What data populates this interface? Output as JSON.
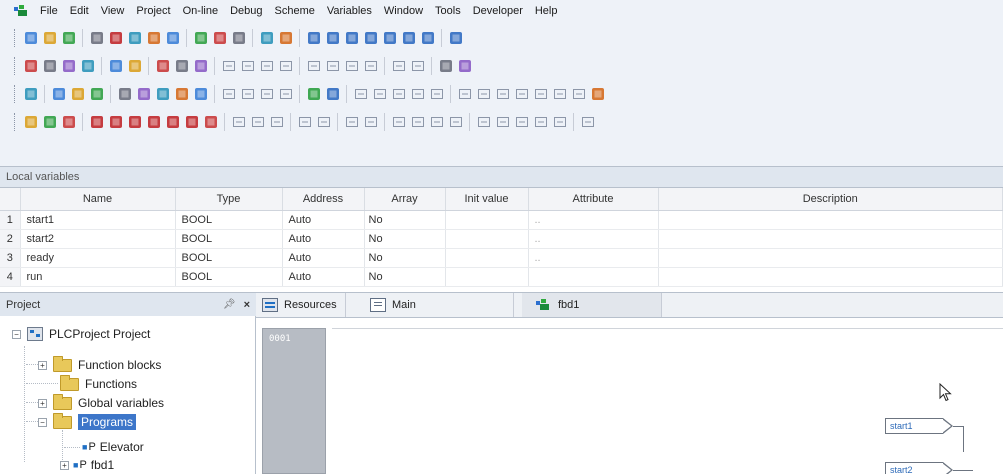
{
  "menu": [
    "File",
    "Edit",
    "View",
    "Project",
    "On-line",
    "Debug",
    "Scheme",
    "Variables",
    "Window",
    "Tools",
    "Developer",
    "Help"
  ],
  "toolbar_rows": [
    [
      "new-file-icon",
      "open-file-icon",
      "save-icon",
      "sep",
      "undo-icon",
      "redo-icon",
      "cut-icon",
      "copy-icon",
      "paste-icon",
      "sep",
      "find-icon",
      "replace-icon",
      "find-next-icon",
      "sep",
      "print-icon",
      "print-preview-icon",
      "sep",
      "window-icon",
      "window-icon",
      "window-icon",
      "window-icon",
      "window-icon",
      "window-icon",
      "window-icon",
      "sep",
      "window-icon"
    ],
    [
      "layout-icon",
      "layout-icon",
      "layout-icon",
      "layout-icon",
      "sep",
      "grid-icon",
      "cursor-icon",
      "sep",
      "rect-icon",
      "pin-icon",
      "arrow-icon",
      "sep",
      "align-icon",
      "align-icon",
      "align-icon",
      "align-icon",
      "sep",
      "align-icon",
      "align-icon",
      "align-icon",
      "align-icon",
      "sep",
      "align-icon",
      "align-icon",
      "sep",
      "chart-icon",
      "flag-icon"
    ],
    [
      "screen-icon",
      "sep",
      "compile-icon",
      "build-icon",
      "build-icon",
      "sep",
      "block-icon",
      "shape-icon",
      "shape-icon",
      "shape-icon",
      "shape-icon",
      "sep",
      "tool-icon",
      "tool-icon",
      "tool-icon",
      "tool-icon",
      "sep",
      "green-icon",
      "blue-icon",
      "sep",
      "ladder-icon",
      "ladder-icon",
      "ladder-icon",
      "ladder-icon",
      "ladder-icon",
      "sep",
      "box-icon",
      "box-icon",
      "box-icon",
      "box-icon",
      "box-icon",
      "box-icon",
      "box-icon",
      "text-icon"
    ],
    [
      "select-icon",
      "line-icon",
      "zoom-icon",
      "sep",
      "red-icon",
      "red-icon",
      "red-icon",
      "red-icon",
      "red-icon",
      "red-icon",
      "connect-icon",
      "sep",
      "gate-icon",
      "gate-icon",
      "gate-icon",
      "sep",
      "gate-icon",
      "gate-icon",
      "sep",
      "gate-icon",
      "gate-icon",
      "sep",
      "gate-icon",
      "gate-icon",
      "gate-icon",
      "gate-icon",
      "sep",
      "gate-icon",
      "gate-icon",
      "gate-icon",
      "gate-icon",
      "gate-icon",
      "sep",
      "gate-icon"
    ]
  ],
  "local_vars": {
    "title": "Local variables",
    "columns": [
      "",
      "Name",
      "Type",
      "Address",
      "Array",
      "Init value",
      "Attribute",
      "Description"
    ],
    "rows": [
      {
        "num": "1",
        "name": "start1",
        "type": "BOOL",
        "address": "Auto",
        "array": "No",
        "init": "",
        "attribute": "..",
        "description": ""
      },
      {
        "num": "2",
        "name": "start2",
        "type": "BOOL",
        "address": "Auto",
        "array": "No",
        "init": "",
        "attribute": "..",
        "description": ""
      },
      {
        "num": "3",
        "name": "ready",
        "type": "BOOL",
        "address": "Auto",
        "array": "No",
        "init": "",
        "attribute": "..",
        "description": ""
      },
      {
        "num": "4",
        "name": "run",
        "type": "BOOL",
        "address": "Auto",
        "array": "No",
        "init": "",
        "attribute": "",
        "description": ""
      }
    ]
  },
  "project": {
    "title": "Project",
    "pin": "⨯",
    "close": "×",
    "root": "PLCProject Project",
    "items": [
      "Function blocks",
      "Functions",
      "Global variables",
      "Programs"
    ],
    "programs": [
      "Elevator",
      "fbd1"
    ],
    "program_prefix": "P"
  },
  "tabs": [
    "Resources",
    "Main",
    "fbd1"
  ],
  "editor": {
    "row_number": "0001",
    "inputs": [
      "start1",
      "start2"
    ]
  }
}
